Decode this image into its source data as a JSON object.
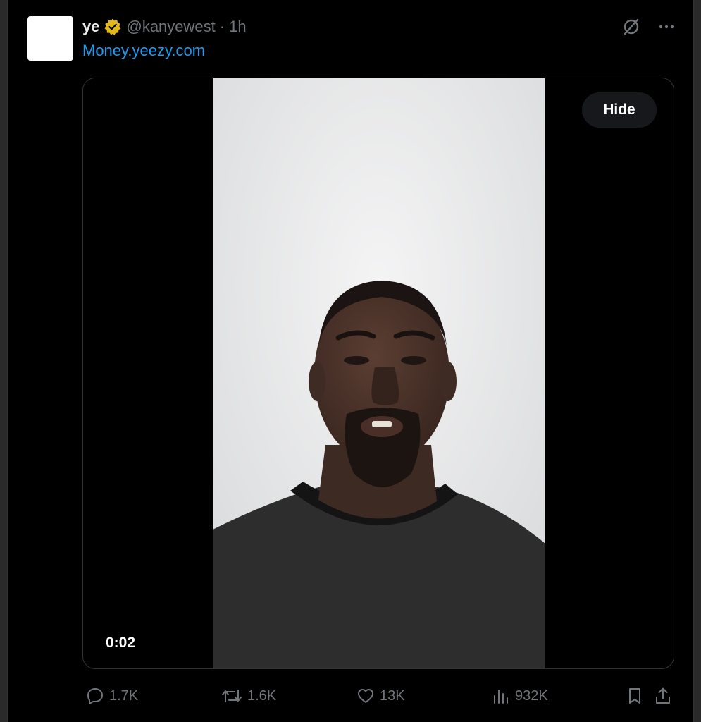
{
  "tweet": {
    "author": {
      "display_name": "ye",
      "handle": "@kanyewest",
      "separator": "·",
      "time": "1h"
    },
    "text": "Money.yeezy.com",
    "media": {
      "hide_label": "Hide",
      "duration": "0:02"
    },
    "stats": {
      "replies": "1.7K",
      "reposts": "1.6K",
      "likes": "13K",
      "views": "932K"
    }
  },
  "icons": {
    "verified": "verified-badge-icon",
    "grok": "grok-icon",
    "more": "more-icon",
    "reply": "reply-icon",
    "repost": "repost-icon",
    "like": "like-icon",
    "views": "views-icon",
    "bookmark": "bookmark-icon",
    "share": "share-icon"
  },
  "colors": {
    "background": "#000000",
    "link": "#1d9bf0",
    "secondary_text": "#71767b",
    "verified_badge": "#e2b719"
  }
}
